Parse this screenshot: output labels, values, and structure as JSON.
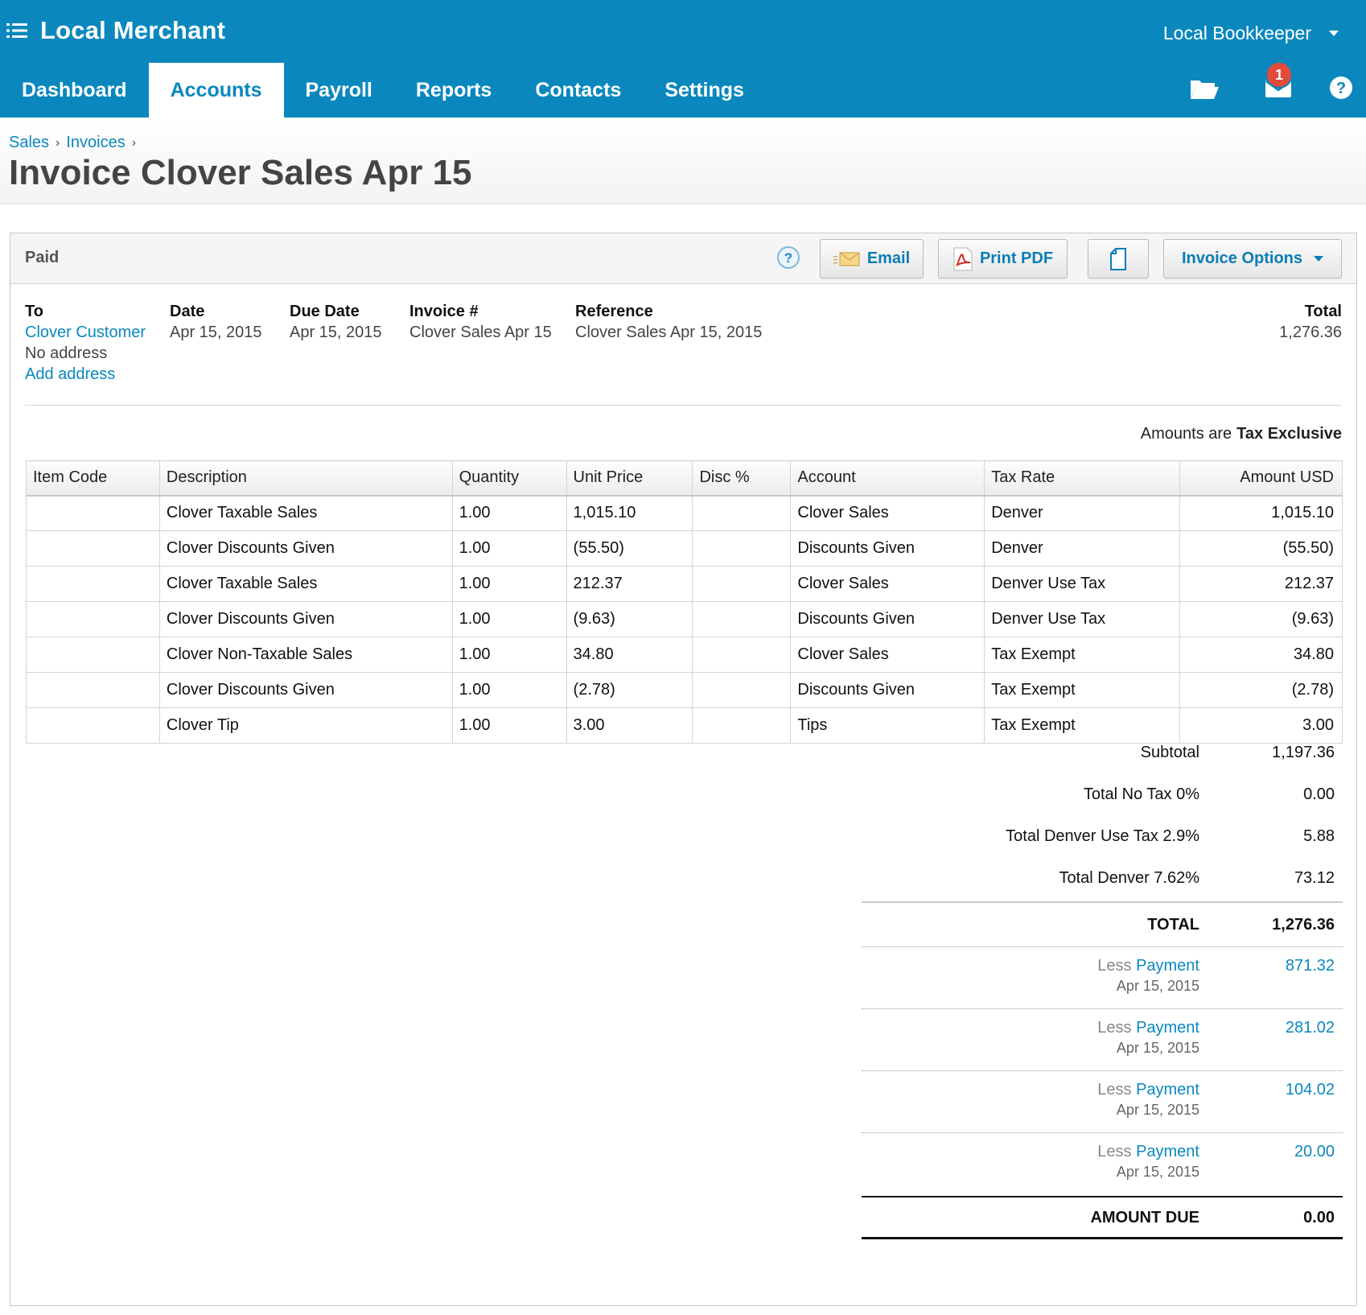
{
  "header": {
    "org_name": "Local Merchant",
    "user_name": "Local Bookkeeper",
    "tabs": [
      {
        "label": "Dashboard",
        "active": false
      },
      {
        "label": "Accounts",
        "active": true
      },
      {
        "label": "Payroll",
        "active": false
      },
      {
        "label": "Reports",
        "active": false
      },
      {
        "label": "Contacts",
        "active": false
      },
      {
        "label": "Settings",
        "active": false
      }
    ],
    "icons": [
      "menu-icon",
      "folder-icon",
      "mail-icon",
      "help-icon"
    ],
    "notification_count": "1",
    "brand_color": "#0a88bd"
  },
  "breadcrumb": [
    "Sales",
    "Invoices"
  ],
  "page_title": "Invoice Clover Sales Apr 15",
  "invoice": {
    "status": "Paid",
    "buttons": {
      "email": "Email",
      "print_pdf": "Print PDF",
      "options": "Invoice Options"
    },
    "meta": {
      "to_label": "To",
      "to_name": "Clover Customer",
      "to_address": "No address",
      "add_address": "Add address",
      "date_label": "Date",
      "date": "Apr 15, 2015",
      "due_label": "Due Date",
      "due_date": "Apr 15, 2015",
      "invoice_label": "Invoice #",
      "invoice_number": "Clover Sales Apr 15",
      "reference_label": "Reference",
      "reference": "Clover Sales Apr 15, 2015",
      "total_label": "Total",
      "total": "1,276.36"
    },
    "amounts_are_label": "Amounts are",
    "amounts_are_value": "Tax Exclusive",
    "columns": [
      "Item Code",
      "Description",
      "Quantity",
      "Unit Price",
      "Disc %",
      "Account",
      "Tax Rate",
      "Amount USD"
    ],
    "items": [
      {
        "code": "",
        "description": "Clover Taxable Sales",
        "quantity": "1.00",
        "unit_price": "1,015.10",
        "disc": "",
        "account": "Clover Sales",
        "tax_rate": "Denver",
        "amount": "1,015.10"
      },
      {
        "code": "",
        "description": "Clover Discounts Given",
        "quantity": "1.00",
        "unit_price": "(55.50)",
        "disc": "",
        "account": "Discounts Given",
        "tax_rate": "Denver",
        "amount": "(55.50)"
      },
      {
        "code": "",
        "description": "Clover Taxable Sales",
        "quantity": "1.00",
        "unit_price": "212.37",
        "disc": "",
        "account": "Clover Sales",
        "tax_rate": "Denver Use Tax",
        "amount": "212.37"
      },
      {
        "code": "",
        "description": "Clover Discounts Given",
        "quantity": "1.00",
        "unit_price": "(9.63)",
        "disc": "",
        "account": "Discounts Given",
        "tax_rate": "Denver Use Tax",
        "amount": "(9.63)"
      },
      {
        "code": "",
        "description": "Clover Non-Taxable Sales",
        "quantity": "1.00",
        "unit_price": "34.80",
        "disc": "",
        "account": "Clover Sales",
        "tax_rate": "Tax Exempt",
        "amount": "34.80"
      },
      {
        "code": "",
        "description": "Clover Discounts Given",
        "quantity": "1.00",
        "unit_price": "(2.78)",
        "disc": "",
        "account": "Discounts Given",
        "tax_rate": "Tax Exempt",
        "amount": "(2.78)"
      },
      {
        "code": "",
        "description": "Clover Tip",
        "quantity": "1.00",
        "unit_price": "3.00",
        "disc": "",
        "account": "Tips",
        "tax_rate": "Tax Exempt",
        "amount": "3.00"
      }
    ],
    "totals": {
      "subtotal_label": "Subtotal",
      "subtotal": "1,197.36",
      "taxes": [
        {
          "label": "Total No Tax 0%",
          "value": "0.00"
        },
        {
          "label": "Total Denver Use Tax 2.9%",
          "value": "5.88"
        },
        {
          "label": "Total Denver 7.62%",
          "value": "73.12"
        }
      ],
      "total_label": "TOTAL",
      "total": "1,276.36",
      "payments": [
        {
          "less": "Less",
          "link": "Payment",
          "date": "Apr 15, 2015",
          "amount": "871.32"
        },
        {
          "less": "Less",
          "link": "Payment",
          "date": "Apr 15, 2015",
          "amount": "281.02"
        },
        {
          "less": "Less",
          "link": "Payment",
          "date": "Apr 15, 2015",
          "amount": "104.02"
        },
        {
          "less": "Less",
          "link": "Payment",
          "date": "Apr 15, 2015",
          "amount": "20.00"
        }
      ],
      "amount_due_label": "AMOUNT DUE",
      "amount_due": "0.00"
    }
  }
}
